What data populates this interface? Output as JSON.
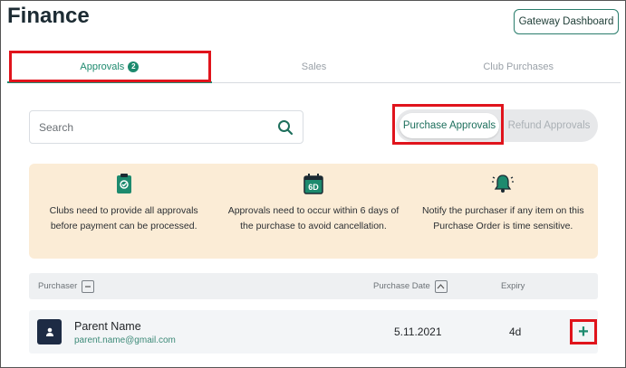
{
  "page": {
    "title": "Finance"
  },
  "header": {
    "gateway_button": "Gateway Dashboard"
  },
  "tabs": [
    {
      "label": "Approvals",
      "badge": "2",
      "active": true
    },
    {
      "label": "Sales",
      "active": false
    },
    {
      "label": "Club Purchases",
      "active": false
    }
  ],
  "search": {
    "placeholder": "Search",
    "value": ""
  },
  "toggle": {
    "options": [
      {
        "label": "Purchase Approvals",
        "selected": true
      },
      {
        "label": "Refund Approvals",
        "selected": false
      }
    ]
  },
  "info": {
    "background": "#fbecd6",
    "items": [
      {
        "icon": "clipboard-check-icon",
        "text": "Clubs need to provide all approvals before payment can be processed."
      },
      {
        "icon": "calendar-6d-icon",
        "icon_text": "6D",
        "text": "Approvals need to occur within 6 days of the purchase to avoid cancellation."
      },
      {
        "icon": "bell-ringing-icon",
        "text": "Notify the purchaser if any item on this Purchase Order is time sensitive."
      }
    ]
  },
  "table": {
    "columns": [
      {
        "label": "Purchaser",
        "sort_icon": "collapse-minus-icon"
      },
      {
        "label": "Purchase Date",
        "sort_icon": "sort-up-chevron-icon"
      },
      {
        "label": "Expiry"
      }
    ],
    "rows": [
      {
        "name": "Parent Name",
        "email": "parent.name@gmail.com",
        "date": "5.11.2021",
        "expiry": "4d",
        "action": "+"
      }
    ]
  },
  "colors": {
    "accent": "#1d8a6e",
    "highlight": "#e0141c",
    "avatar": "#1d2b44"
  }
}
